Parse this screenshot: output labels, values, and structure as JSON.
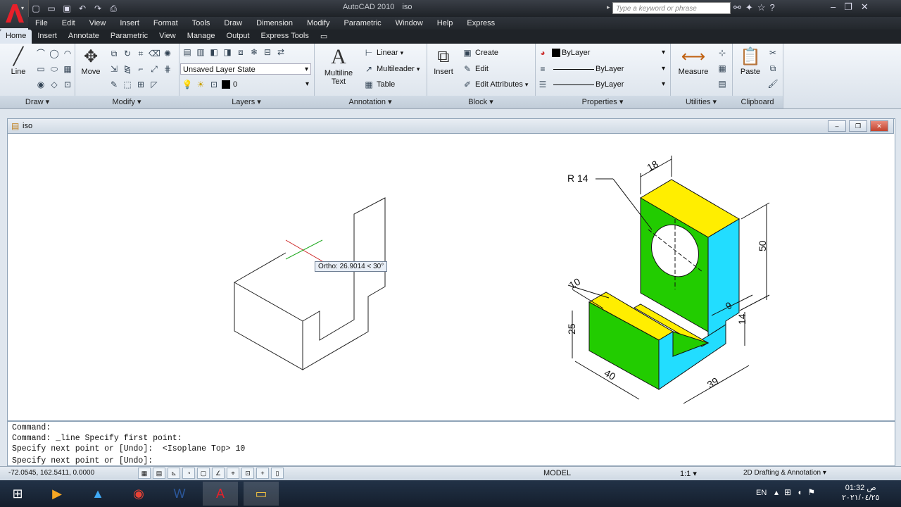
{
  "app": {
    "title": "AutoCAD 2010",
    "document": "iso"
  },
  "search": {
    "placeholder": "Type a keyword or phrase"
  },
  "menubar": [
    "File",
    "Edit",
    "View",
    "Insert",
    "Format",
    "Tools",
    "Draw",
    "Dimension",
    "Modify",
    "Parametric",
    "Window",
    "Help",
    "Express"
  ],
  "ribbon_tabs": [
    "Home",
    "Insert",
    "Annotate",
    "Parametric",
    "View",
    "Manage",
    "Output",
    "Express Tools"
  ],
  "active_tab": "Home",
  "panels": {
    "draw": {
      "title": "Draw",
      "line": "Line"
    },
    "modify": {
      "title": "Modify",
      "move": "Move"
    },
    "layers": {
      "title": "Layers",
      "layer_state": "Unsaved Layer State",
      "layer": "0"
    },
    "annotation": {
      "title": "Annotation",
      "mtext_line1": "Multiline",
      "mtext_line2": "Text",
      "linear": "Linear",
      "multileader": "Multileader",
      "table": "Table"
    },
    "block": {
      "title": "Block",
      "insert": "Insert",
      "create": "Create",
      "edit": "Edit",
      "edit_attributes": "Edit Attributes"
    },
    "properties": {
      "title": "Properties",
      "color": "ByLayer",
      "linetype": "ByLayer",
      "lineweight": "ByLayer"
    },
    "utilities": {
      "title": "Utilities",
      "measure": "Measure"
    },
    "clipboard": {
      "title": "Clipboard",
      "paste": "Paste"
    }
  },
  "drawing": {
    "tooltip": "Ortho: 26.9014 < 30°",
    "dims": {
      "r14": "R 14",
      "d18": "18",
      "d50": "50",
      "d10": "10",
      "d9": "9",
      "d25": "25",
      "d14": "14",
      "d40": "40",
      "d39": "39"
    },
    "colors": {
      "top": "#ffee00",
      "front": "#22cc00",
      "side": "#22ddff"
    }
  },
  "command_lines": [
    "Command:",
    "Command: _line Specify first point:",
    "Specify next point or [Undo]:  <Isoplane Top> 10",
    "Specify next point or [Undo]:"
  ],
  "status": {
    "coords": "-72.0545, 162.5411, 0.0000",
    "model": "MODEL",
    "scale": "1:1",
    "workspace": "2D Drafting & Annotation"
  },
  "taskbar": {
    "lang": "EN",
    "time": "01:32 ص",
    "date": "٢٠٢١/٠٤/٢٥"
  }
}
